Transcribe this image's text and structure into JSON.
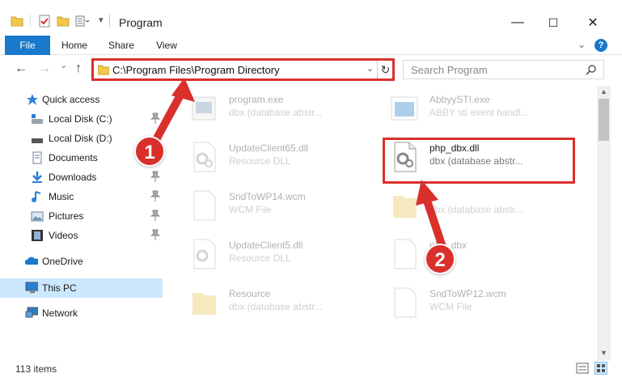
{
  "window": {
    "title": "Program",
    "controls": {
      "minimize": "—",
      "maximize": "☐",
      "close": "✕"
    }
  },
  "ribbon": {
    "tabs": [
      "File",
      "Home",
      "Share",
      "View"
    ],
    "help": "?"
  },
  "nav": {
    "back": "←",
    "forward": "→",
    "recent": "⌄",
    "up": "↑",
    "address": "C:\\Program Files\\Program Directory",
    "search_placeholder": "Search Program"
  },
  "sidebar": {
    "items": [
      {
        "label": "Quick access",
        "icon": "star-icon"
      },
      {
        "label": "Local Disk (C:)",
        "icon": "drive-icon",
        "pinned": true
      },
      {
        "label": "Local Disk (D:)",
        "icon": "drive-icon",
        "pinned": false
      },
      {
        "label": "Documents",
        "icon": "documents-icon",
        "pinned": true
      },
      {
        "label": "Downloads",
        "icon": "downloads-icon",
        "pinned": true
      },
      {
        "label": "Music",
        "icon": "music-icon",
        "pinned": true
      },
      {
        "label": "Pictures",
        "icon": "pictures-icon",
        "pinned": true
      },
      {
        "label": "Videos",
        "icon": "videos-icon",
        "pinned": true
      },
      {
        "label": "OneDrive",
        "icon": "onedrive-icon"
      },
      {
        "label": "This PC",
        "icon": "this-pc-icon",
        "selected": true
      },
      {
        "label": "Network",
        "icon": "network-icon"
      }
    ]
  },
  "files": [
    {
      "name": "program.exe",
      "desc": "dbx (database abstr...",
      "icon": "exe-icon",
      "faded": true
    },
    {
      "name": "AbbyySTI.exe",
      "desc": "ABBY sti event handl...",
      "icon": "exe-blue-icon",
      "faded": true
    },
    {
      "name": "UpdateClient65.dll",
      "desc": "Resource DLL",
      "icon": "dll-gear-icon",
      "faded": true
    },
    {
      "name": "php_dbx.dll",
      "desc": "dbx (database abstr...",
      "icon": "dll-gear-icon",
      "faded": false
    },
    {
      "name": "SndToWP14.wcm",
      "desc": "WCM File",
      "icon": "file-icon",
      "faded": true
    },
    {
      "name": "",
      "desc": "dbx (database abstr...",
      "icon": "folder-icon",
      "faded": true
    },
    {
      "name": "UpdateClient5.dll",
      "desc": "Resource DLL",
      "icon": "dll-gear-icon",
      "faded": true
    },
    {
      "name": "php_dbx",
      "desc": "",
      "icon": "file-icon",
      "faded": true
    },
    {
      "name": "Resource",
      "desc": "dbx (database abstr...",
      "icon": "folder-icon",
      "faded": true
    },
    {
      "name": "SndToWP12.wcm",
      "desc": "WCM File",
      "icon": "file-icon",
      "faded": true
    }
  ],
  "status": {
    "count": "113 items"
  },
  "annotations": {
    "step1": "1",
    "step2": "2",
    "accent": "#d9302c"
  },
  "colors": {
    "accent": "#1979ca",
    "selection": "#cce8ff",
    "highlight": "#d9302c"
  }
}
